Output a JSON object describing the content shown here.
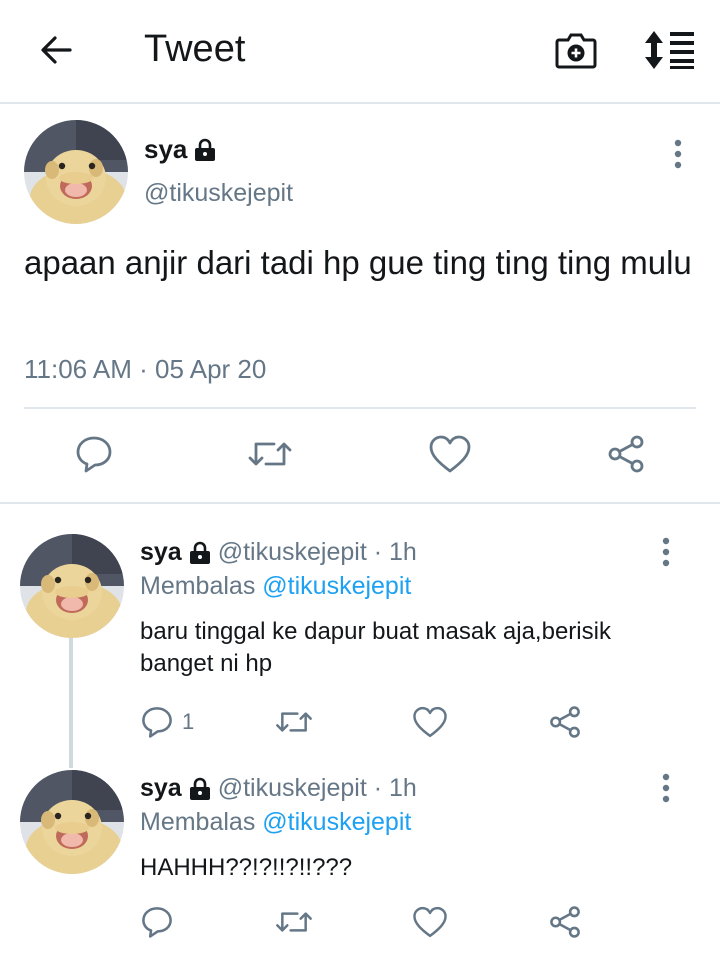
{
  "header": {
    "title": "Tweet"
  },
  "main_tweet": {
    "name": "sya",
    "handle": "@tikuskejepit",
    "text": "apaan anjir dari tadi hp gue ting ting ting mulu",
    "timestamp": "11:06 AM · 05 Apr 20"
  },
  "replies": [
    {
      "name": "sya",
      "handle_time": "@tikuskejepit · 1h",
      "replying_prefix": "Membalas",
      "replying_to": "@tikuskejepit",
      "text": "baru tinggal ke dapur buat masak aja,berisik banget ni hp",
      "reply_count": "1"
    },
    {
      "name": "sya",
      "handle_time": "@tikuskejepit · 1h",
      "replying_prefix": "Membalas",
      "replying_to": "@tikuskejepit",
      "text": "HAHHH??!?!!?!!???",
      "reply_count": ""
    }
  ],
  "colors": {
    "accent": "#1da1f2",
    "secondary_text": "#657786",
    "icon": "#657786",
    "divider": "#e1e8ed"
  }
}
